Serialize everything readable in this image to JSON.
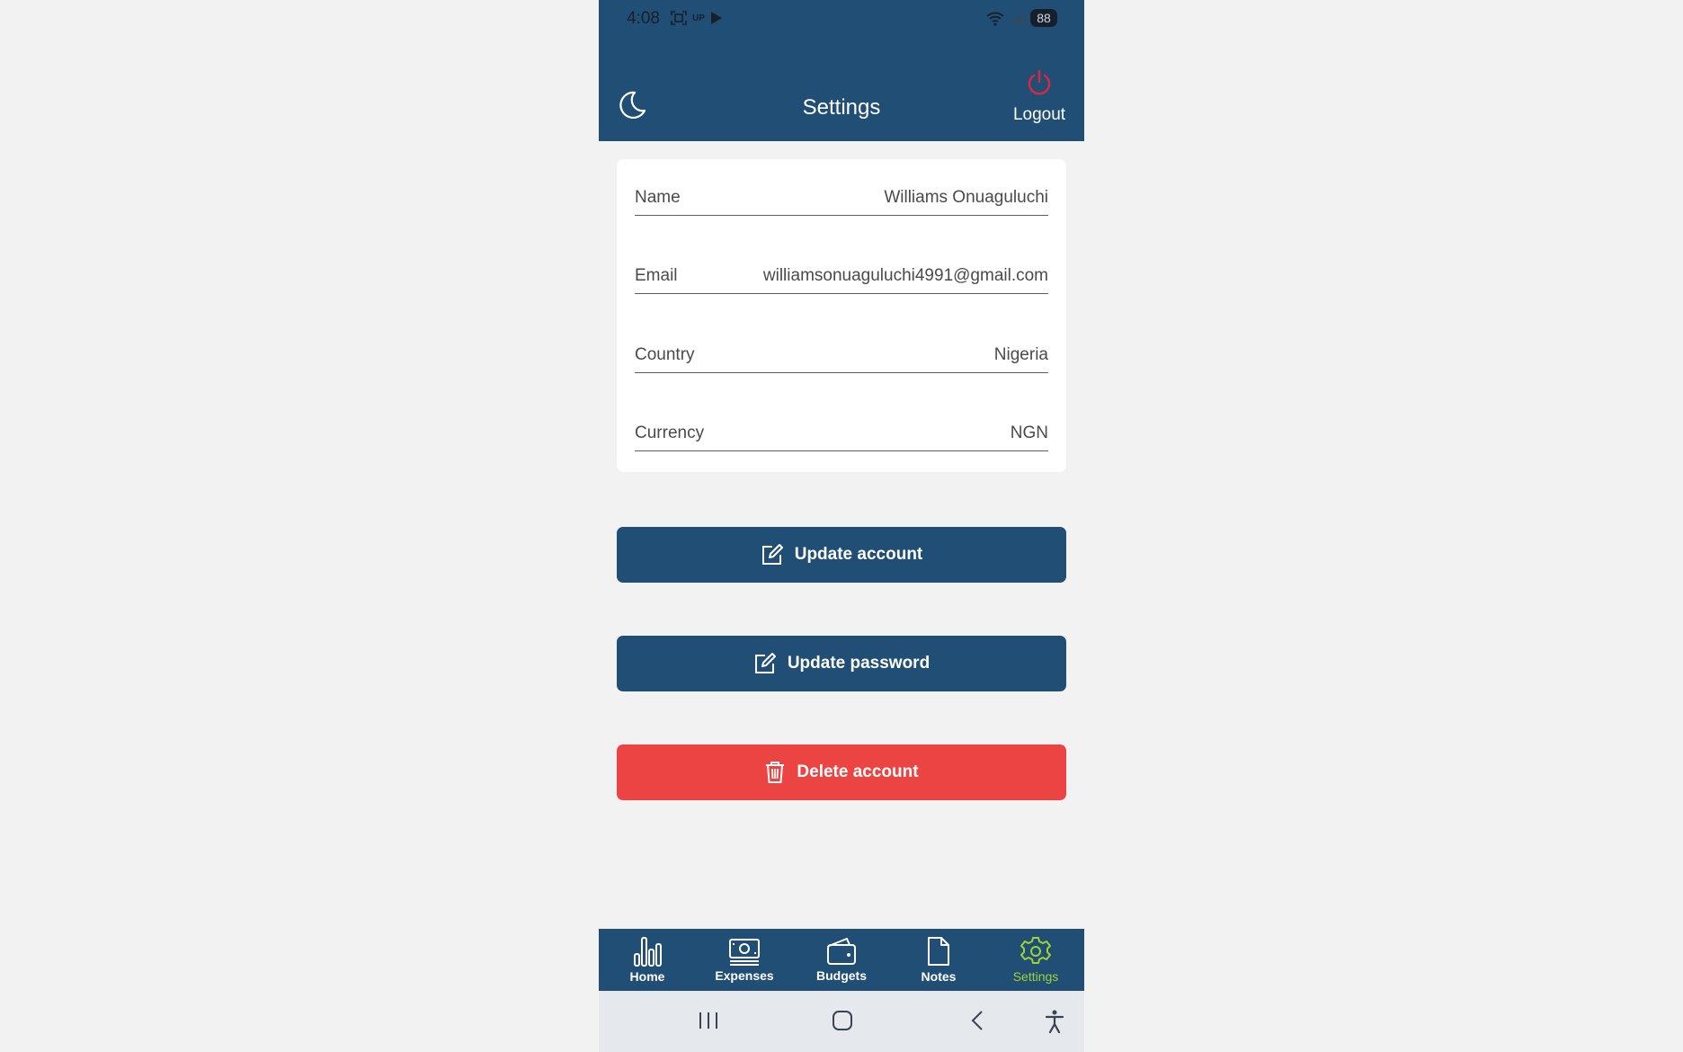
{
  "status_bar": {
    "time": "4:08",
    "small_label": "UP",
    "battery": "88"
  },
  "header": {
    "title": "Settings",
    "logout_label": "Logout",
    "logout_color": "#e0263a",
    "theme_icon": "moon-icon"
  },
  "form": {
    "fields": [
      {
        "label": "Name",
        "value": "Williams Onuaguluchi"
      },
      {
        "label": "Email",
        "value": "williamsonuaguluchi4991@gmail.com"
      },
      {
        "label": "Country",
        "value": "Nigeria"
      },
      {
        "label": "Currency",
        "value": "NGN"
      }
    ]
  },
  "buttons": {
    "update_account": "Update account",
    "update_password": "Update password",
    "delete_account": "Delete account"
  },
  "nav": {
    "items": [
      {
        "label": "Home",
        "icon": "bar-chart-icon"
      },
      {
        "label": "Expenses",
        "icon": "cash-icon"
      },
      {
        "label": "Budgets",
        "icon": "wallet-icon"
      },
      {
        "label": "Notes",
        "icon": "document-icon"
      },
      {
        "label": "Settings",
        "icon": "gear-icon",
        "active": true
      }
    ],
    "active_color": "#9cd33a"
  },
  "colors": {
    "primary": "#214e75",
    "danger": "#ec4343",
    "background": "#f2f2f2"
  }
}
